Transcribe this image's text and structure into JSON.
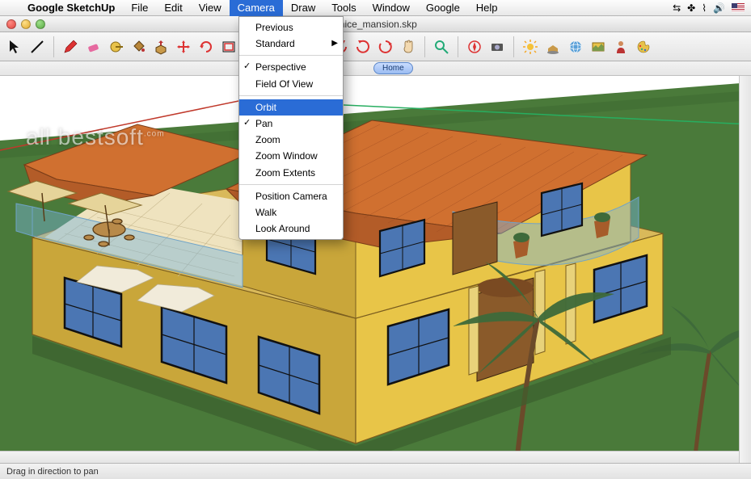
{
  "menubar": {
    "apple": "",
    "app_name": "Google SketchUp",
    "items": [
      "File",
      "Edit",
      "View",
      "Camera",
      "Draw",
      "Tools",
      "Window",
      "Google",
      "Help"
    ],
    "active_index": 3,
    "system_icons": [
      "switch",
      "bluetooth",
      "wifi",
      "volume",
      "flag"
    ]
  },
  "window": {
    "filename": "_nice_mansion.skp"
  },
  "toolbar": {
    "groups": [
      [
        "select",
        "line"
      ],
      [
        "pencil",
        "eraser",
        "tape",
        "paint",
        "pushpull",
        "move",
        "rotate",
        "offset"
      ],
      [
        "orbit",
        "pan",
        "zoom"
      ],
      [
        "rewind",
        "play",
        "forward",
        "birdhouse"
      ],
      [
        "magnifier"
      ],
      [
        "compass",
        "camera"
      ],
      [
        "sun",
        "shadow",
        "globe",
        "panorama",
        "person",
        "palette"
      ]
    ]
  },
  "home_strip": {
    "label": "Home"
  },
  "camera_menu": {
    "sections": [
      [
        {
          "label": "Previous",
          "checked": false,
          "submenu": false
        },
        {
          "label": "Standard",
          "checked": false,
          "submenu": true
        }
      ],
      [
        {
          "label": "Perspective",
          "checked": true,
          "submenu": false
        },
        {
          "label": "Field Of View",
          "checked": false,
          "submenu": false
        }
      ],
      [
        {
          "label": "Orbit",
          "checked": false,
          "submenu": false,
          "highlighted": true
        },
        {
          "label": "Pan",
          "checked": true,
          "submenu": false
        },
        {
          "label": "Zoom",
          "checked": false,
          "submenu": false
        },
        {
          "label": "Zoom Window",
          "checked": false,
          "submenu": false
        },
        {
          "label": "Zoom Extents",
          "checked": false,
          "submenu": false
        }
      ],
      [
        {
          "label": "Position Camera",
          "checked": false,
          "submenu": false
        },
        {
          "label": "Walk",
          "checked": false,
          "submenu": false
        },
        {
          "label": "Look Around",
          "checked": false,
          "submenu": false
        }
      ]
    ]
  },
  "status": {
    "hint": "Drag in direction to pan"
  },
  "watermark": {
    "text": "all bestsoft",
    "suffix": ".com"
  },
  "colors": {
    "grass": "#4a7a3a",
    "ground_shadow": "#3f6a32",
    "wall": "#e8c548",
    "wall_shade": "#c9a63a",
    "roof": "#d07030",
    "roof_shade": "#b35c28",
    "window_frame": "#1a1a1a",
    "window_glass": "#4b76b3",
    "glass_rail": "rgba(120,180,220,0.45)",
    "trim": "#9a7c38",
    "palm_trunk": "#6b4a2a",
    "palm_leaf": "#3e6a3a"
  }
}
